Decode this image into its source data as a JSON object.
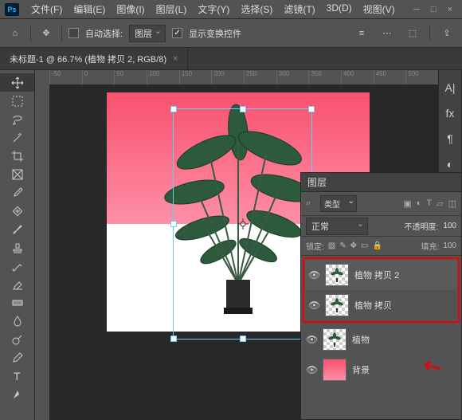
{
  "menu": [
    "文件(F)",
    "编辑(E)",
    "图像(I)",
    "图层(L)",
    "文字(Y)",
    "选择(S)",
    "滤镜(T)",
    "3D(D)",
    "视图(V)"
  ],
  "toolbar": {
    "auto_select": "自动选择:",
    "selector": "图层",
    "show_controls": "显示变换控件"
  },
  "doc_tab": "未标题-1 @ 66.7% (植物 拷贝 2, RGB/8)",
  "ruler_marks": [
    "-50",
    "0",
    "50",
    "100",
    "150",
    "200",
    "250",
    "300",
    "350",
    "400",
    "450",
    "500"
  ],
  "right_icons": [
    "A|",
    "fx",
    "¶",
    "◐"
  ],
  "panel": {
    "title": "图层",
    "type_filter": "类型",
    "blend_mode": "正常",
    "opacity_label": "不透明度:",
    "opacity": "100",
    "lock_label": "锁定:",
    "fill_label": "填充:",
    "fill": "100"
  },
  "layers": [
    {
      "name": "植物 拷贝 2",
      "eye": true,
      "isPlant": true
    },
    {
      "name": "植物 拷贝",
      "eye": true,
      "isPlant": true
    },
    {
      "name": "植物",
      "eye": true,
      "isPlant": true
    },
    {
      "name": "背景",
      "eye": true,
      "isPlant": false
    }
  ]
}
